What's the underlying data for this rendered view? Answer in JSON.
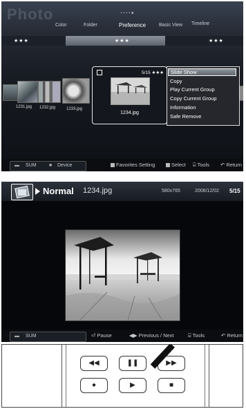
{
  "browser": {
    "title": "Photo",
    "tabs": [
      "Color",
      "Folder",
      "Preference",
      "Basic View",
      "Timeline"
    ],
    "active_tab": "Preference",
    "rating_left": "★★★",
    "rating_mid": "★★★",
    "rating_right": "★★★",
    "thumbnails": [
      "1231.jpg",
      "1232.jpg",
      "1233.jpg"
    ],
    "selected": {
      "counter": "5/15",
      "stars": "★★★",
      "filename": "1234.jpg"
    },
    "menu": [
      "Slide Show",
      "Copy",
      "Play Current Group",
      "Copy Current Group",
      "Information",
      "Safe Remove"
    ],
    "bottom": {
      "sum": "SUM",
      "device": "Device",
      "favorites": "Favorites Setting",
      "select": "Select",
      "tools": "Tools",
      "return": "Return"
    }
  },
  "slideshow": {
    "mode": "Normal",
    "filename": "1234.jpg",
    "resolution": "580x765",
    "date": "2008/12/02",
    "counter": "5/15",
    "bottom": {
      "sum": "SUM",
      "pause": "Pause",
      "prevnext": "Previous / Next",
      "tools": "Tools",
      "return": "Return"
    }
  },
  "remote": {
    "buttons": [
      "rewind-icon",
      "pause-icon",
      "fast-forward-icon",
      "record-icon",
      "play-icon",
      "stop-icon"
    ]
  },
  "colors": {
    "accent": "#8d939c",
    "panel_bg": "#171b22"
  }
}
